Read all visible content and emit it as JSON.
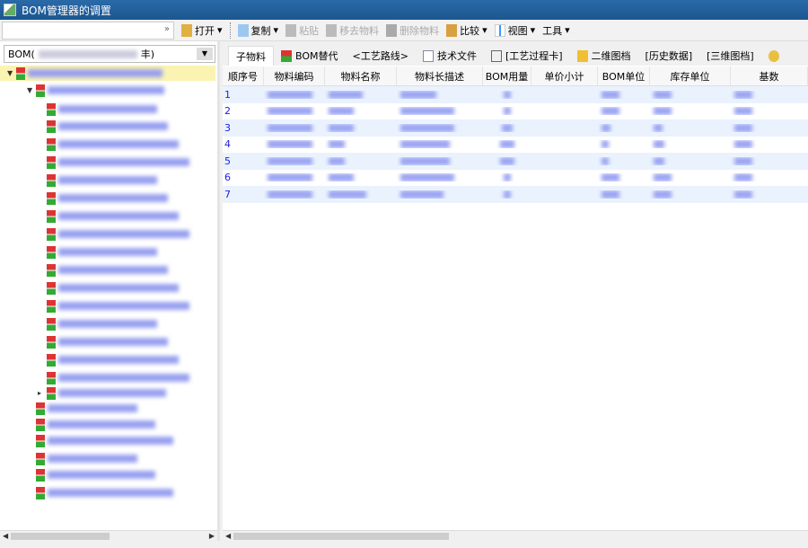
{
  "window": {
    "title": "BOM管理器的调置"
  },
  "toolbar": {
    "search_value": "",
    "items": [
      {
        "label": "打开",
        "icon": "folder-icon",
        "enabled": true,
        "dropdown": true
      },
      {
        "label": "复制",
        "icon": "copy-icon",
        "enabled": true,
        "dropdown": true
      },
      {
        "label": "粘贴",
        "icon": "paste-icon",
        "enabled": false
      },
      {
        "label": "移去物料",
        "icon": "remove-icon",
        "enabled": false
      },
      {
        "label": "删除物料",
        "icon": "trash-icon",
        "enabled": false
      },
      {
        "label": "比较",
        "icon": "scale-icon",
        "enabled": true,
        "dropdown": true
      },
      {
        "label": "视图",
        "icon": "view-icon",
        "enabled": true,
        "dropdown": true
      },
      {
        "label": "工具",
        "icon": "",
        "enabled": true,
        "dropdown": true
      }
    ]
  },
  "left": {
    "combo_prefix": "BOM(",
    "combo_suffix": "丰)"
  },
  "tabs": [
    {
      "label": "子物料",
      "icon": "",
      "active": true
    },
    {
      "label": "BOM替代",
      "icon": "bom-icon"
    },
    {
      "label": "<工艺路线>",
      "icon": ""
    },
    {
      "label": "技术文件",
      "icon": "document-icon"
    },
    {
      "label": "[工艺过程卡]",
      "icon": "card-icon"
    },
    {
      "label": "二维图档",
      "icon": "drawing-icon"
    },
    {
      "label": "[历史数据]",
      "icon": ""
    },
    {
      "label": "[三维图档]",
      "icon": ""
    },
    {
      "label": "",
      "icon": "model-icon"
    }
  ],
  "table": {
    "columns": [
      "顺序号",
      "物料编码",
      "物料名称",
      "物料长描述",
      "BOM用量",
      "单价小计",
      "BOM单位",
      "库存单位",
      "基数"
    ],
    "rows": [
      "1",
      "2",
      "3",
      "4",
      "5",
      "6",
      "7"
    ]
  },
  "colors": {
    "title_bar": "#1c5690",
    "selected_row": "#fbf3b2",
    "row_alt": "#eaf2fe",
    "link": "#2020e0"
  }
}
